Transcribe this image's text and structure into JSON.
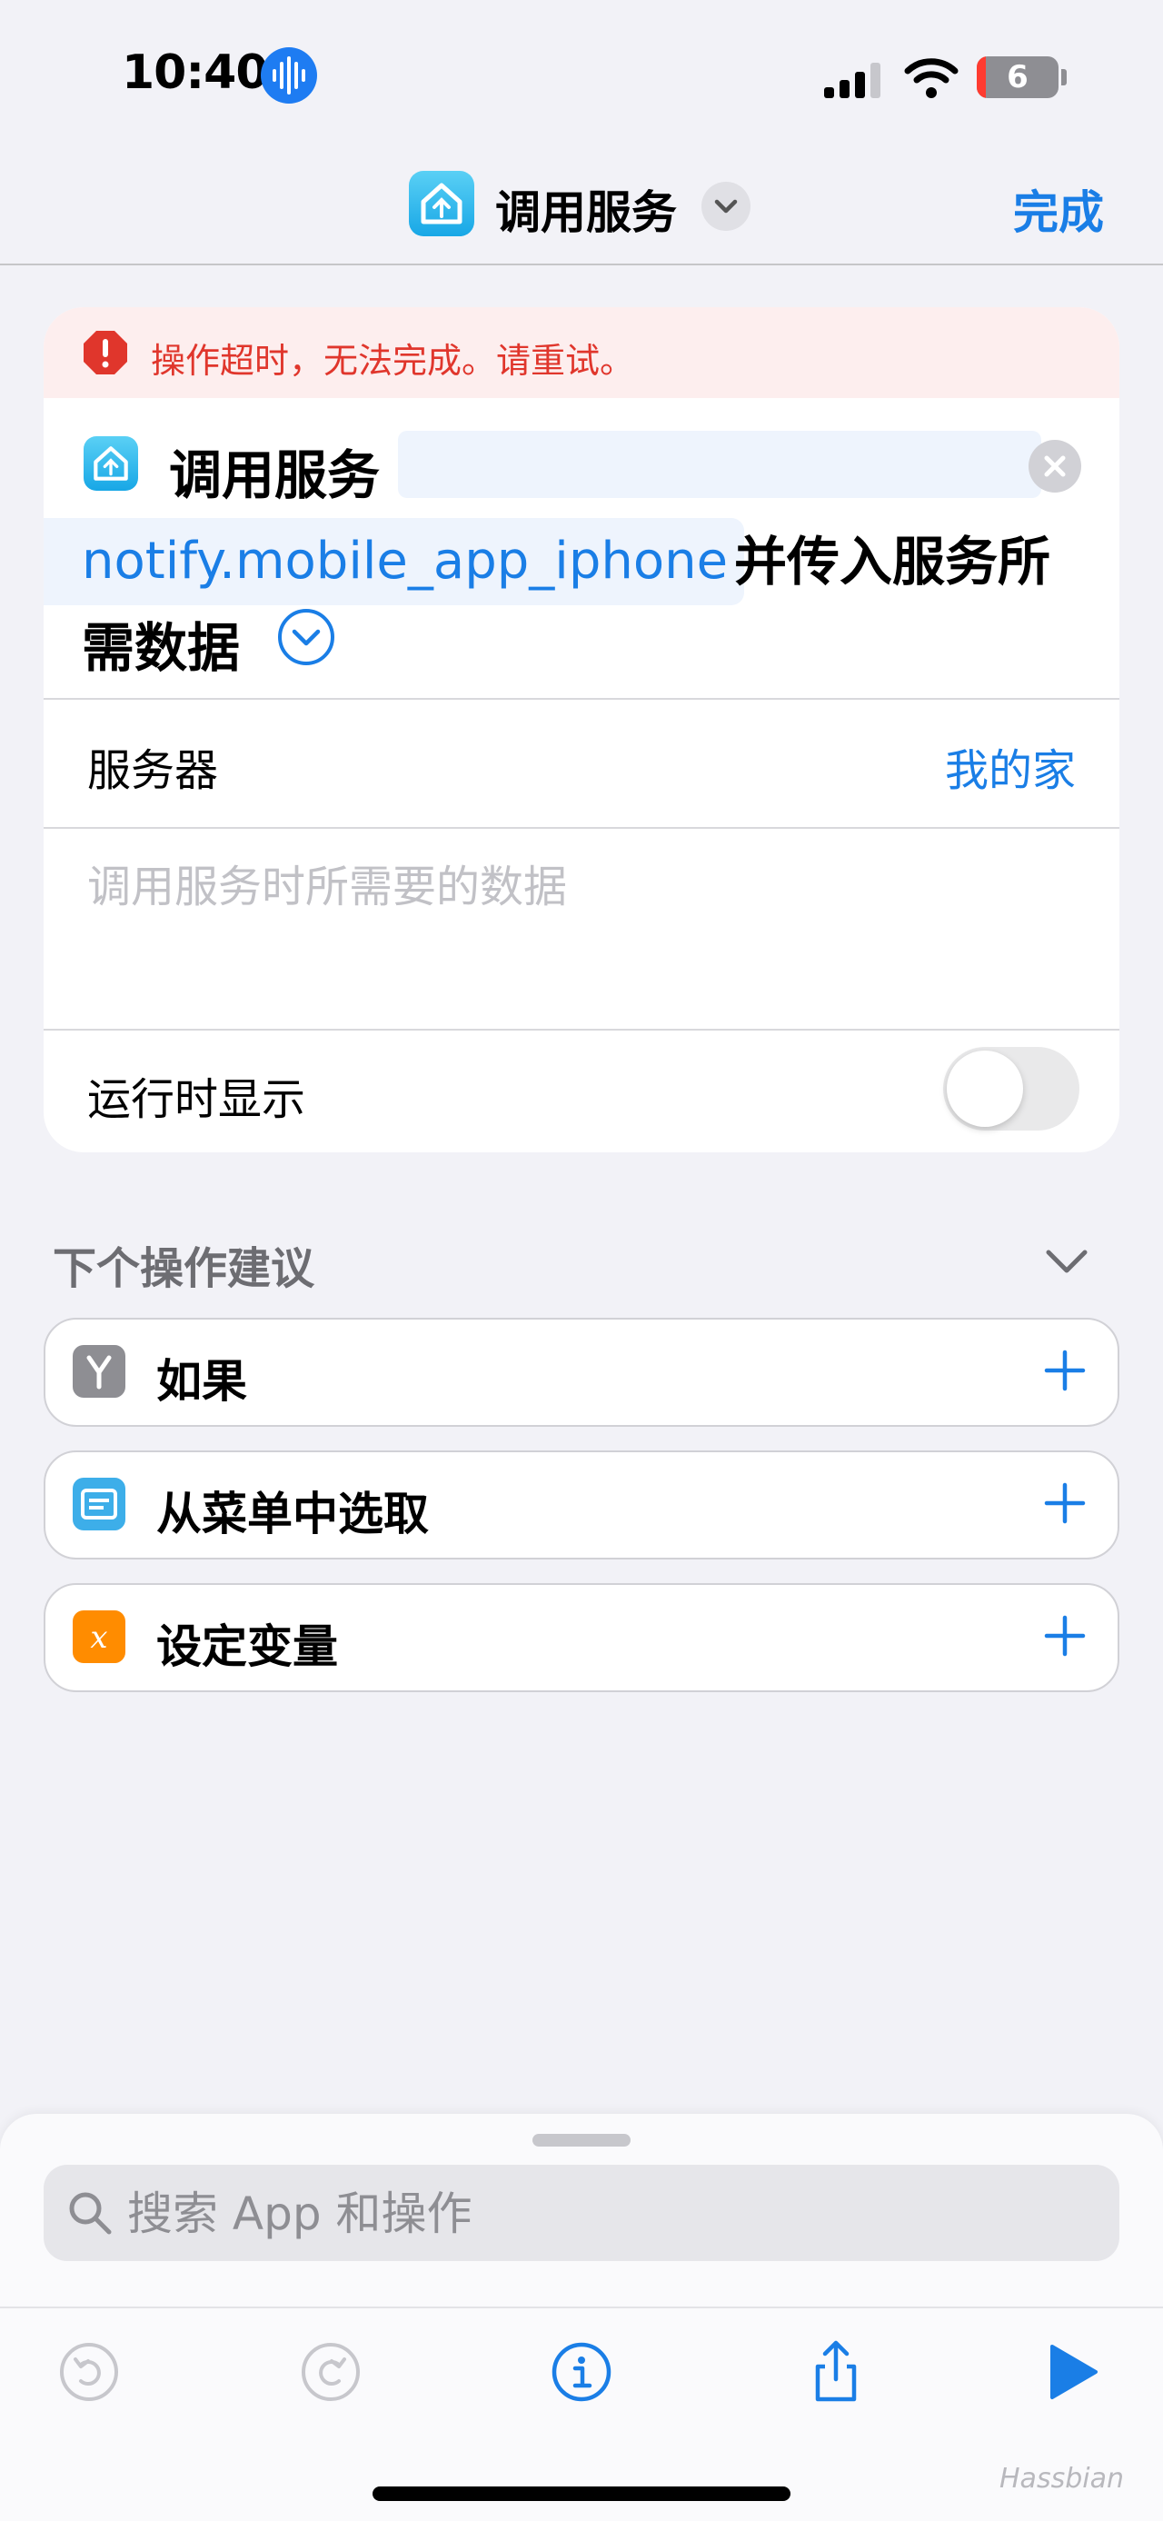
{
  "status_bar": {
    "time": "10:40",
    "battery_level": "6"
  },
  "nav": {
    "title": "调用服务",
    "done_label": "完成"
  },
  "action": {
    "error_message": "操作超时，无法完成。请重试。",
    "call_label": "调用服务",
    "service_name": "notify.mobile_app_iphone",
    "suffix_part1": "并传入服务所",
    "suffix_part2": "需数据",
    "server_label": "服务器",
    "server_value": "我的家",
    "data_placeholder": "调用服务时所需要的数据",
    "show_when_run_label": "运行时显示",
    "show_when_run": false
  },
  "suggestions": {
    "title": "下个操作建议",
    "items": [
      {
        "label": "如果",
        "icon": "branch-icon",
        "color": "#8e8e93"
      },
      {
        "label": "从菜单中选取",
        "icon": "menu-icon",
        "color": "#3daee9"
      },
      {
        "label": "设定变量",
        "icon": "variable-icon",
        "color": "#ff8c00"
      }
    ]
  },
  "search": {
    "placeholder": "搜索 App 和操作"
  },
  "watermark": "Hassbian",
  "colors": {
    "accent": "#1a7ee6",
    "error": "#e0362c",
    "background": "#f2f2f7"
  }
}
